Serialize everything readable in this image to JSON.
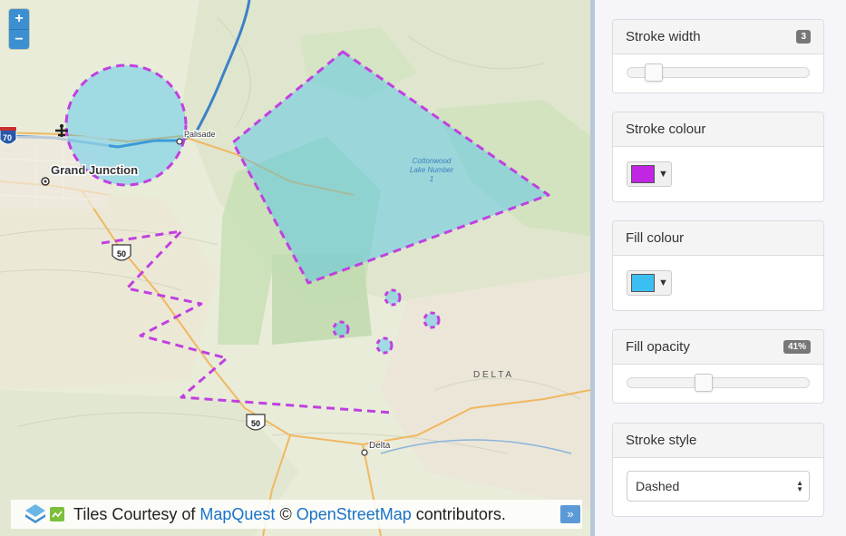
{
  "map": {
    "zoom_in_label": "+",
    "zoom_out_label": "−",
    "labels": {
      "city_grand_junction": "Grand Junction",
      "town_palisade": "Palisade",
      "town_delta": "Delta",
      "region_delta": "D E L T A",
      "lake_name_line1": "Cottonwood",
      "lake_name_line2": "Lake Number",
      "lake_name_line3": "1",
      "route_i70": "70",
      "route_us50_north": "50",
      "route_us50_south": "50"
    },
    "attribution": {
      "prefix": "Tiles Courtesy of ",
      "mapquest_link": "MapQuest",
      "copyright": " © ",
      "osm_link": "OpenStreetMap",
      "suffix": " contributors.",
      "collapse_label": "»"
    },
    "shapes": {
      "stroke_color": "#c040e0",
      "fill_color": "#3bc0f0",
      "fill_opacity": 0.41
    }
  },
  "panel": {
    "stroke_width": {
      "title": "Stroke width",
      "value": "3",
      "slider_value": 3,
      "slider_min": 1,
      "slider_max": 20
    },
    "stroke_colour": {
      "title": "Stroke colour",
      "color": "#c026e4",
      "caret": "▼"
    },
    "fill_colour": {
      "title": "Fill colour",
      "color": "#3bbff2",
      "caret": "▼"
    },
    "fill_opacity": {
      "title": "Fill opacity",
      "value": "41%",
      "slider_fraction": 0.41
    },
    "stroke_style": {
      "title": "Stroke style",
      "selected": "Dashed",
      "arrow_up": "▲",
      "arrow_down": "▼"
    }
  }
}
